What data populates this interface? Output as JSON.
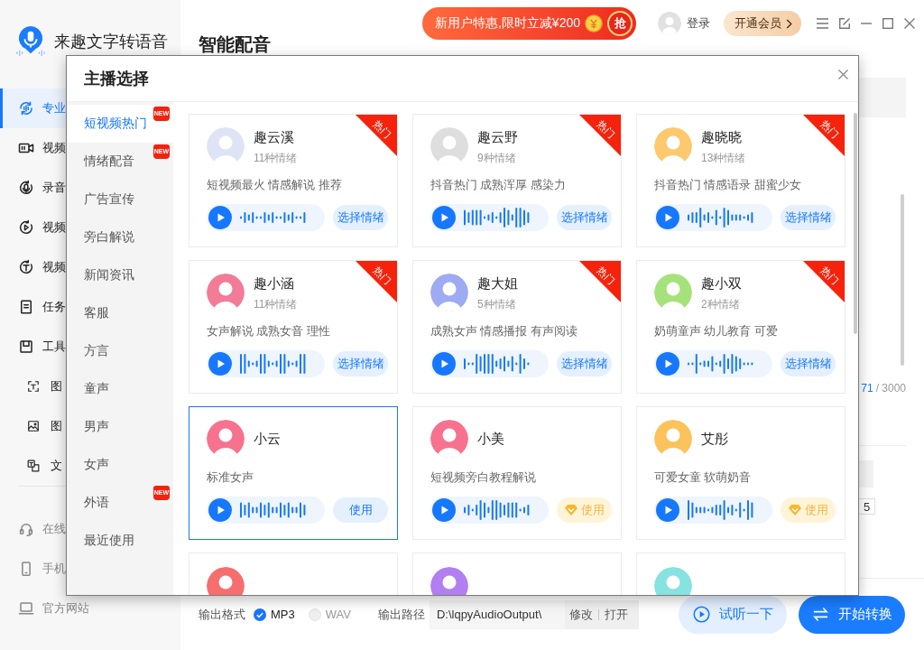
{
  "app": {
    "name": "来趣文字转语音"
  },
  "sidebar": {
    "items": [
      {
        "label": "专业",
        "selected": true
      },
      {
        "label": "视频",
        "selected": false
      },
      {
        "label": "录音",
        "selected": false
      },
      {
        "label": "视频",
        "selected": false
      },
      {
        "label": "视频",
        "selected": false
      },
      {
        "label": "任务",
        "selected": false
      },
      {
        "label": "工具",
        "selected": false,
        "children": [
          {
            "label": "图",
            "selected": false
          },
          {
            "label": "图",
            "selected": false
          },
          {
            "label": "文",
            "selected": false
          }
        ]
      }
    ],
    "links": [
      "在线",
      "手机",
      "官方网站"
    ]
  },
  "header": {
    "promo": "新用户特惠,限时立减¥200",
    "promo_button": "抢",
    "login": "登录",
    "vip": "开通会员"
  },
  "page": {
    "title": "智能配音"
  },
  "dialog": {
    "title": "主播选择",
    "categories": [
      {
        "label": "短视频热门",
        "selected": true,
        "badge": "NEW"
      },
      {
        "label": "情绪配音",
        "selected": false,
        "badge": "NEW"
      },
      {
        "label": "广告宣传",
        "selected": false
      },
      {
        "label": "旁白解说",
        "selected": false
      },
      {
        "label": "新闻资讯",
        "selected": false
      },
      {
        "label": "客服",
        "selected": false
      },
      {
        "label": "方言",
        "selected": false
      },
      {
        "label": "童声",
        "selected": false
      },
      {
        "label": "男声",
        "selected": false
      },
      {
        "label": "女声",
        "selected": false
      },
      {
        "label": "外语",
        "selected": false,
        "badge": "NEW"
      },
      {
        "label": "最近使用",
        "selected": false
      }
    ],
    "voices": [
      {
        "name": "趣云溪",
        "emotions": "11种情绪",
        "tags": "短视频最火 情感解说 推荐",
        "hot": "热门",
        "action": {
          "label": "选择情绪",
          "kind": "emotion"
        },
        "selected": false,
        "color": "#dfe3f6"
      },
      {
        "name": "趣云野",
        "emotions": "9种情绪",
        "tags": "抖音热门 成熟浑厚 感染力",
        "hot": "热门",
        "action": {
          "label": "选择情绪",
          "kind": "emotion"
        },
        "selected": false,
        "color": "#dedede"
      },
      {
        "name": "趣晓晓",
        "emotions": "13种情绪",
        "tags": "抖音热门 情感语录 甜蜜少女",
        "hot": "热门",
        "action": {
          "label": "选择情绪",
          "kind": "emotion"
        },
        "selected": false,
        "color": "#fcc96e"
      },
      {
        "name": "趣小涵",
        "emotions": "11种情绪",
        "tags": "女声解说 成熟女音 理性",
        "hot": "热门",
        "action": {
          "label": "选择情绪",
          "kind": "emotion"
        },
        "selected": false,
        "color": "#f27b98"
      },
      {
        "name": "趣大姐",
        "emotions": "5种情绪",
        "tags": "成熟女声 情感播报 有声阅读",
        "hot": "热门",
        "action": {
          "label": "选择情绪",
          "kind": "emotion"
        },
        "selected": false,
        "color": "#9eaaf2"
      },
      {
        "name": "趣小双",
        "emotions": "2种情绪",
        "tags": "奶萌童声 幼儿教育 可爱",
        "hot": "热门",
        "action": {
          "label": "选择情绪",
          "kind": "emotion"
        },
        "selected": false,
        "color": "#a6e27c"
      },
      {
        "name": "小云",
        "tags": "标准女声",
        "action": {
          "label": "使用",
          "kind": "use"
        },
        "selected": true,
        "color": "#f7728e"
      },
      {
        "name": "小美",
        "tags": "短视频旁白教程解说",
        "action": {
          "label": "使用",
          "kind": "vip"
        },
        "selected": false,
        "color": "#f7728e"
      },
      {
        "name": "艾彤",
        "tags": "可爱女童 软萌奶音",
        "action": {
          "label": "使用",
          "kind": "vip"
        },
        "selected": false,
        "color": "#fcc35c"
      },
      {
        "selected": false,
        "color": "#f76e6e"
      },
      {
        "selected": false,
        "color": "#b27ff0"
      },
      {
        "selected": false,
        "color": "#86e3df"
      }
    ]
  },
  "editor": {
    "count": "71",
    "limit": "/ 3000",
    "number": "5"
  },
  "output": {
    "format_label": "输出格式",
    "formats": [
      {
        "label": "MP3",
        "selected": true
      },
      {
        "label": "WAV",
        "selected": false
      }
    ],
    "path_label": "输出路径",
    "path": "D:\\lqpyAudioOutput\\",
    "path_actions": [
      "修改",
      "打开"
    ]
  },
  "actions": [
    {
      "label": "试听一下",
      "kind": "preview"
    },
    {
      "label": "开始转换",
      "kind": "convert"
    }
  ]
}
